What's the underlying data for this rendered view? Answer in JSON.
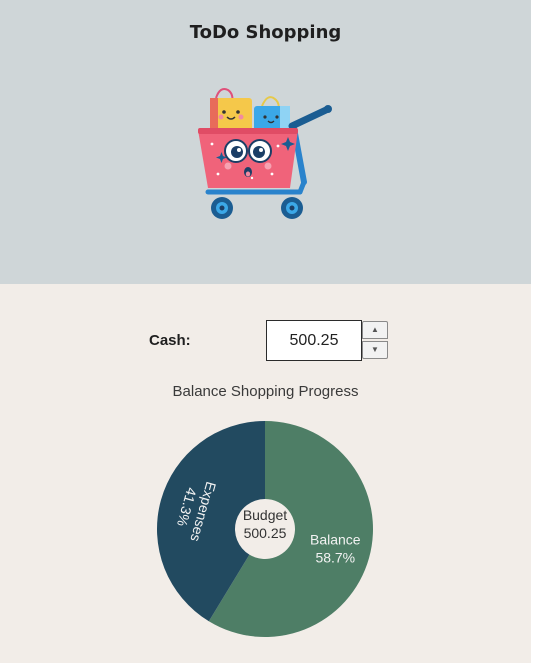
{
  "app": {
    "title": "ToDo Shopping"
  },
  "cash": {
    "label": "Cash:",
    "value": "500.25"
  },
  "chart_data": {
    "type": "pie",
    "title": "Balance Shopping Progress",
    "center_label": "Budget",
    "center_value": "500.25",
    "slices": [
      {
        "label": "Expenses",
        "value": 41.3,
        "value_label": "41.3%",
        "color": "#224a60"
      },
      {
        "label": "Balance",
        "value": 58.7,
        "value_label": "58.7%",
        "color": "#4e7e66"
      }
    ]
  },
  "icons": {
    "hero": "shopping-cart-illustration",
    "spin_up": "chevron-up-icon",
    "spin_down": "chevron-down-icon"
  },
  "colors": {
    "header_bg": "#cfd6d8",
    "content_bg": "#f2ede8",
    "expenses": "#224a60",
    "balance": "#4e7e66"
  }
}
